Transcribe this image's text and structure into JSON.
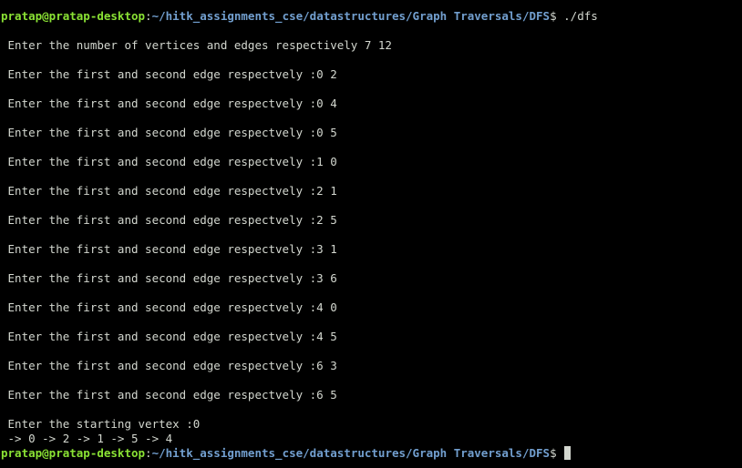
{
  "prompt": {
    "user_host": "pratap@pratap-desktop",
    "colon": ":",
    "path": "~/hitk_assignments_cse/datastructures/Graph Traversals/DFS",
    "symbol": "$ "
  },
  "first_command": "./dfs",
  "output": {
    "vertices_edges_prompt": " Enter the number of vertices and edges respectively 7 12",
    "edge_prompts": [
      " Enter the first and second edge respectvely :0 2",
      " Enter the first and second edge respectvely :0 4",
      " Enter the first and second edge respectvely :0 5",
      " Enter the first and second edge respectvely :1 0",
      " Enter the first and second edge respectvely :2 1",
      " Enter the first and second edge respectvely :2 5",
      " Enter the first and second edge respectvely :3 1",
      " Enter the first and second edge respectvely :3 6",
      " Enter the first and second edge respectvely :4 0",
      " Enter the first and second edge respectvely :4 5",
      " Enter the first and second edge respectvely :6 3",
      " Enter the first and second edge respectvely :6 5"
    ],
    "starting_vertex_prompt": " Enter the starting vertex :0",
    "traversal_result": " -> 0 -> 2 -> 1 -> 5 -> 4"
  }
}
